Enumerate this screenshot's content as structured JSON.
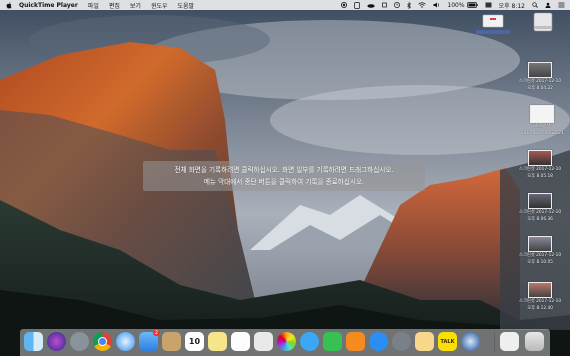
{
  "menubar": {
    "app_name": "QuickTime Player",
    "menus": [
      "파일",
      "편집",
      "보기",
      "윈도우",
      "도움말"
    ],
    "battery": "100%",
    "clock": "오후 8:12"
  },
  "overlay": {
    "line1": "전체 화면을 기록하려면 클릭하십시오. 화면 일부를 기록하려면 드래그하십시오.",
    "line2": "메뉴 막대에서 중단 버튼을 클릭하여 기록을 종료하십시오."
  },
  "desktop": {
    "icons": [
      {
        "line1": "스크린샷 2017-12-10",
        "line2": "오후 8.04.22"
      },
      {
        "line1": "스크린샷",
        "line2": "2017-12-...10.22.21"
      },
      {
        "line1": "스크린샷 2017-12-10",
        "line2": "오후 8.05.18"
      },
      {
        "line1": "스크린샷 2017-12-10",
        "line2": "오후 8.06.36"
      },
      {
        "line1": "스크린샷 2017-12-10",
        "line2": "오후 8.10.05"
      },
      {
        "line1": "스크린샷 2017-12-10",
        "line2": "오후 8.12.40"
      }
    ]
  },
  "dock": {
    "badges": {
      "mail": "2",
      "appstore_calendar_day": "10",
      "kakaotalk": "TALK"
    },
    "icons": [
      "finder-icon",
      "siri-icon",
      "launchpad-icon",
      "chrome-icon",
      "safari-icon",
      "mail-icon",
      "notes-icon",
      "calendar-icon",
      "stickies-icon",
      "reminders-icon",
      "photos-icon",
      "messages-icon",
      "facetime-icon",
      "ibooks-icon",
      "app-store-icon",
      "system-preferences-icon",
      "editor-app-icon",
      "kakaotalk-icon",
      "quicktime-icon",
      "documents-icon",
      "trash-icon"
    ]
  }
}
